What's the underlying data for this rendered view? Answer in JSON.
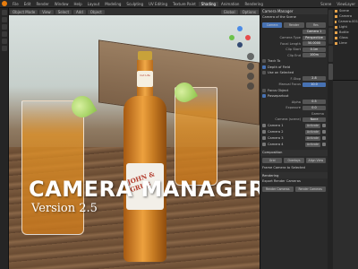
{
  "app": {
    "workspace_tabs": [
      "File",
      "Edit",
      "Render",
      "Window",
      "Help",
      "Layout",
      "Modeling",
      "Sculpting",
      "UV Editing",
      "Texture Paint",
      "Shading",
      "Animation",
      "Rendering",
      "Compositing",
      "Geometry Nodes",
      "Scripting"
    ],
    "active_tab": "Shading",
    "options_label": "Options",
    "scene_label": "Scene",
    "view_layer_label": "ViewLayer"
  },
  "toolbar": {
    "mode": "Object Mode",
    "view": "View",
    "select": "Select",
    "add": "Add",
    "object": "Object",
    "orientation": "Global"
  },
  "overlay": {
    "title": "CAMERA MANAGER",
    "version": "Version 2.5"
  },
  "bottle": {
    "label_text": "Cut Life",
    "brand": "JOHN & GRUB"
  },
  "camera_panel": {
    "header": "Camera Manager",
    "scene_camera_label": "Camera of the Scene",
    "tabs": [
      "Camera",
      "Render",
      "Res"
    ],
    "active_camera": "Camera 1",
    "camera_type_label": "Camera Type",
    "camera_type_value": "Perspective",
    "focal_length_label": "Focal Length",
    "focal_length_value": "50.0000",
    "clip_start_label": "Clip Start",
    "clip_start_value": "0.1m",
    "clip_end_label": "Clip End",
    "clip_end_value": "100m",
    "track_to_label": "Track To",
    "depth_of_field_label": "Depth of Field",
    "focus_on_selected_label": "Use on Selected",
    "fstop_label": "F-Stop",
    "fstop_value": "2.8",
    "manual_focus_label": "Manual Focus",
    "manual_focus_value": "10.0",
    "focus_button": "Pick",
    "focus_distance_label": "Focus Object",
    "passepartout_label": "Passepartout",
    "alpha_label": "Alpha",
    "alpha_value": "0.5",
    "exposure_label": "Exposure",
    "exposure_value": "0.0",
    "gamma_label": "Gamma",
    "camera_list_label": "Camera (scene)",
    "camera_list_mode": "None",
    "cameras": [
      {
        "name": "Camera 1",
        "action": "Activate"
      },
      {
        "name": "Camera 2",
        "action": "Activate"
      },
      {
        "name": "Camera 3",
        "action": "Activate"
      },
      {
        "name": "Camera 4",
        "action": "Activate"
      }
    ],
    "composition_label": "Composition",
    "composition_options": [
      "Grid",
      "Overlays",
      "Align View"
    ],
    "frame_camera_label": "Frame Camera to Selected",
    "rendering_label": "Rendering",
    "export_label": "Export Render Cameras",
    "render_buttons": [
      "Render Cameras",
      "Render Cameras"
    ]
  },
  "outliner": {
    "items": [
      "Scene",
      "Camera",
      "Camera.001",
      "Light",
      "Bottle",
      "Glass",
      "Lime"
    ]
  },
  "colors": {
    "accent_blue": "#4772b3",
    "blender_orange": "#e87d0d",
    "panel_bg": "#2a2a2a"
  }
}
